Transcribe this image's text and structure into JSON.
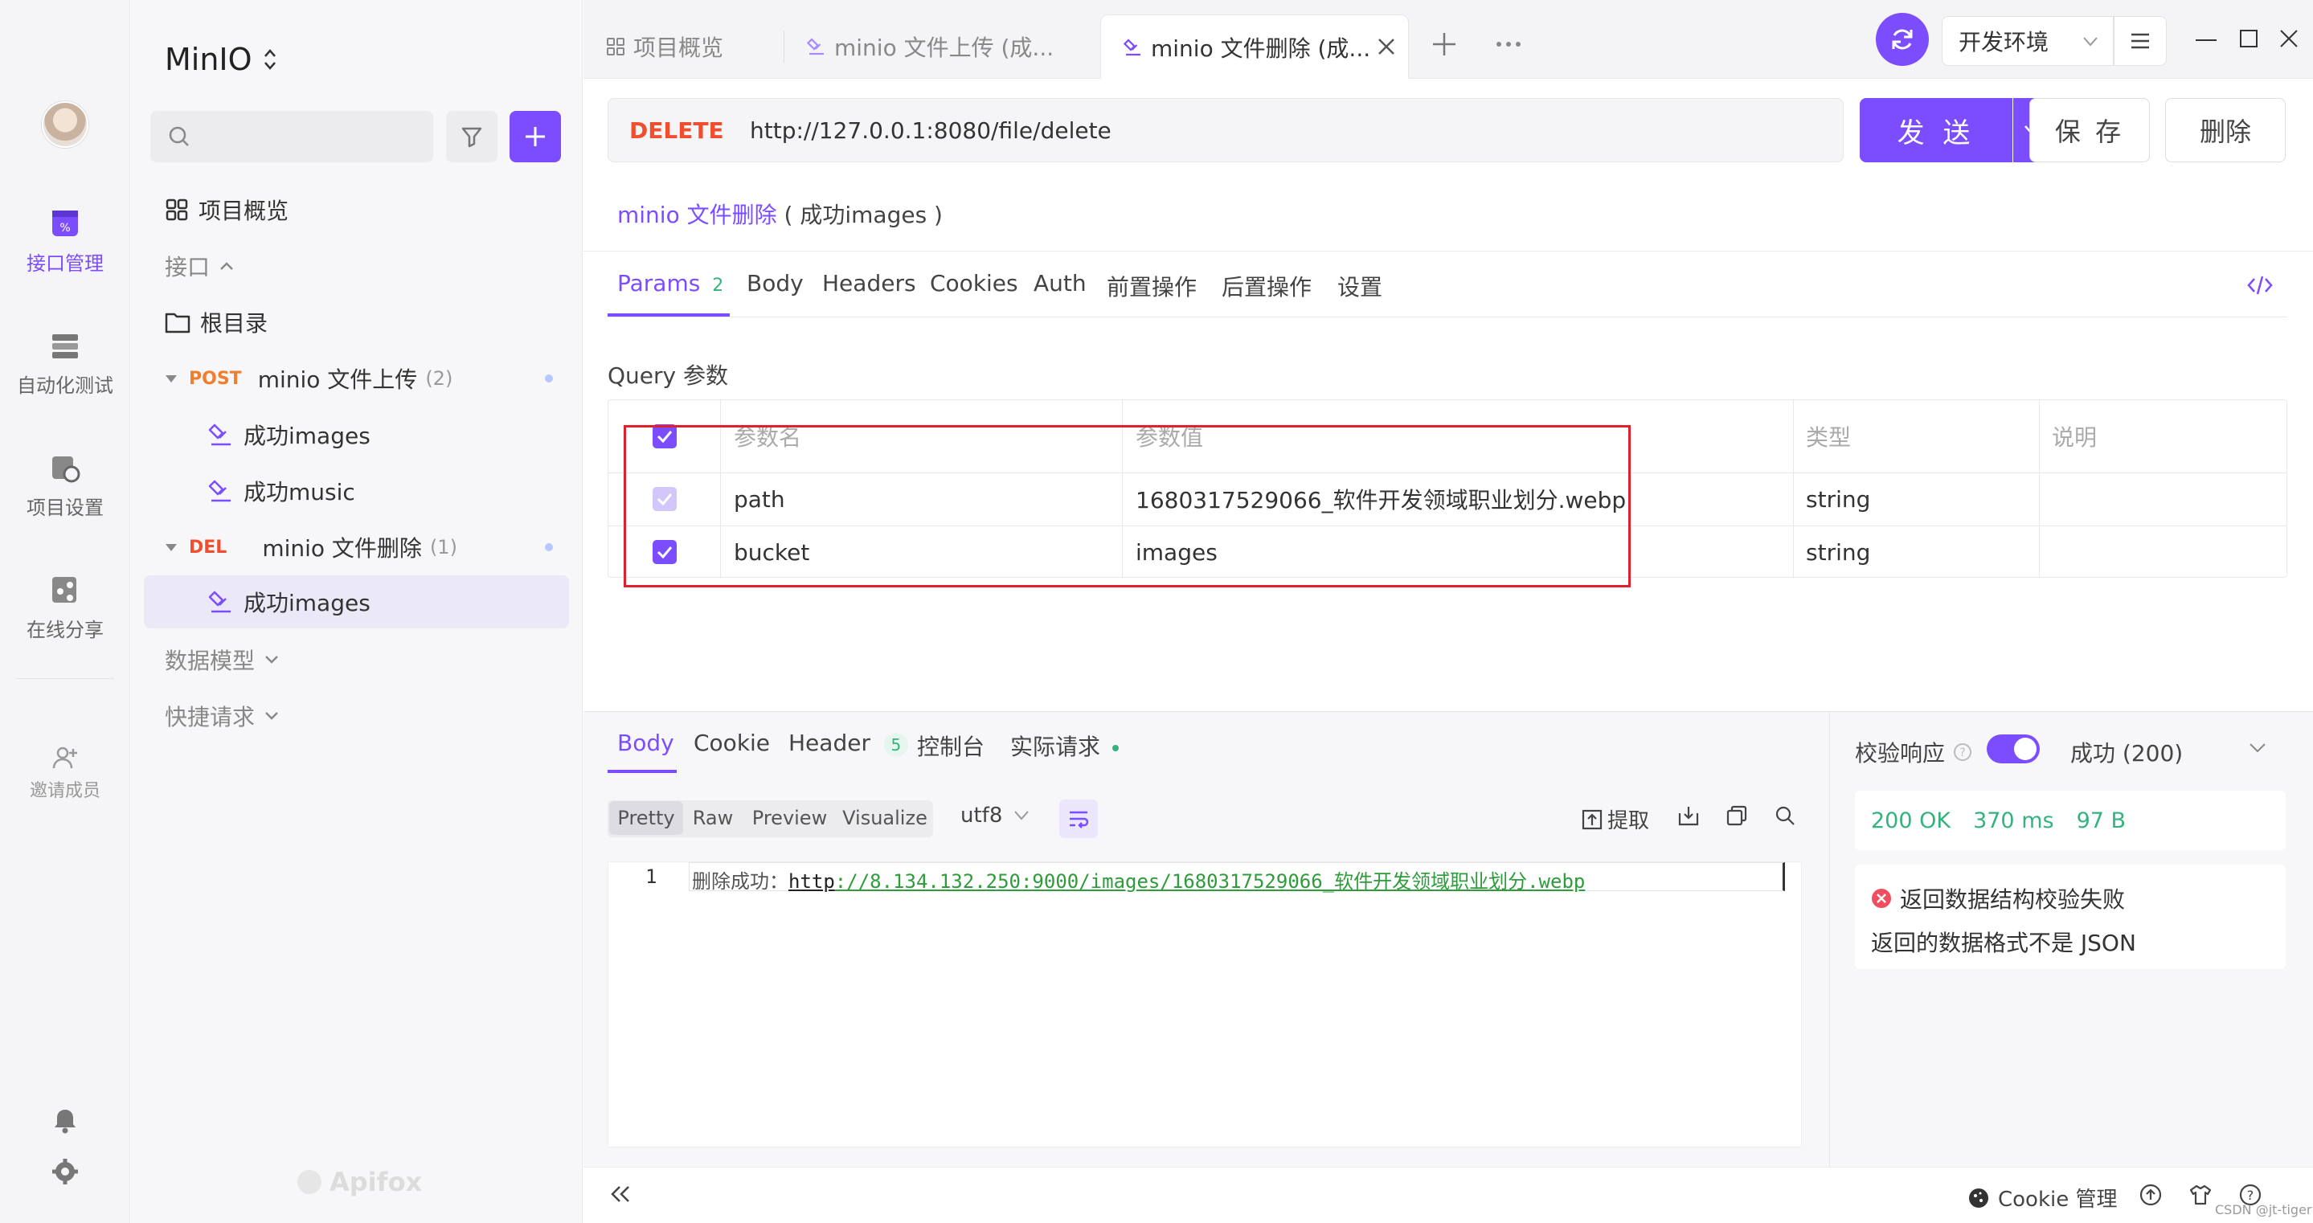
{
  "project": {
    "name": "MinIO"
  },
  "rail": {
    "items": [
      {
        "label": "接口管理",
        "icon": "api-icon"
      },
      {
        "label": "自动化测试",
        "icon": "automation-icon"
      },
      {
        "label": "项目设置",
        "icon": "settings-icon"
      },
      {
        "label": "在线分享",
        "icon": "share-icon"
      },
      {
        "label": "邀请成员",
        "icon": "invite-icon"
      }
    ]
  },
  "sidebar": {
    "search_placeholder": "",
    "overview": "项目概览",
    "api_section": "接口",
    "root": "根目录",
    "folders": [
      {
        "method": "POST",
        "name": "minio 文件上传",
        "count": "(2)",
        "children": [
          "成功images",
          "成功music"
        ]
      },
      {
        "method": "DEL",
        "name": "minio 文件删除",
        "count": "(1)",
        "children": [
          "成功images"
        ]
      }
    ],
    "data_model": "数据模型",
    "quick_request": "快捷请求",
    "watermark": "Apifox"
  },
  "tabs": [
    {
      "label": "项目概览"
    },
    {
      "label": "minio 文件上传 (成..."
    },
    {
      "label": "minio 文件删除 (成..."
    }
  ],
  "env": {
    "label": "开发环境"
  },
  "request": {
    "method": "DELETE",
    "url": "http://127.0.0.1:8080/file/delete",
    "send": "发 送",
    "save": "保 存",
    "delete": "删除",
    "breadcrumb_link": "minio 文件删除",
    "breadcrumb_case": "( 成功images )"
  },
  "req_tabs": {
    "params": "Params",
    "params_count": "2",
    "body": "Body",
    "headers": "Headers",
    "cookies": "Cookies",
    "auth": "Auth",
    "pre": "前置操作",
    "post": "后置操作",
    "settings": "设置"
  },
  "query": {
    "title": "Query 参数",
    "columns": {
      "name": "参数名",
      "value": "参数值",
      "type": "类型",
      "desc": "说明"
    },
    "rows": [
      {
        "name": "path",
        "value": "1680317529066_软件开发领域职业划分.webp",
        "type": "string",
        "desc": ""
      },
      {
        "name": "bucket",
        "value": "images",
        "type": "string",
        "desc": ""
      }
    ]
  },
  "response": {
    "tabs": {
      "body": "Body",
      "cookie": "Cookie",
      "header": "Header",
      "header_count": "5",
      "console": "控制台",
      "actual": "实际请求"
    },
    "view_modes": [
      "Pretty",
      "Raw",
      "Preview",
      "Visualize"
    ],
    "encoding": "utf8",
    "extract": "提取",
    "line_no": "1",
    "body_prefix": "删除成功：",
    "body_url_a": "http",
    "body_url_b": "://8.134.132.250:9000/images/1680317529066_软件开发领域职业划分.webp",
    "validate_label": "校验响应",
    "validate_status": "成功 (200)",
    "status_ok": "200 OK",
    "time": "370 ms",
    "size": "97 B",
    "error_title": "返回数据结构校验失败",
    "error_desc": "返回的数据格式不是 JSON"
  },
  "footer": {
    "cookie_mgr": "Cookie 管理",
    "watermark": "CSDN @jt-tiger"
  }
}
